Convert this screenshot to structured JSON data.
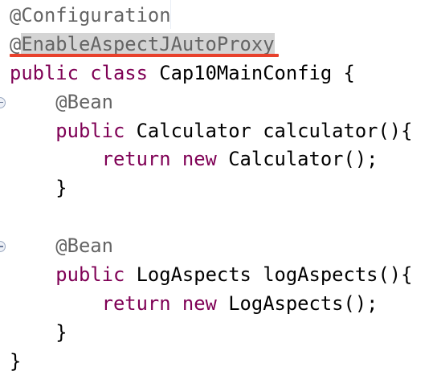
{
  "editor": {
    "lines": [
      {
        "tokens": [
          {
            "t": "@Configuration",
            "c": "ann"
          }
        ]
      },
      {
        "tokens": [
          {
            "t": "@",
            "c": "ann"
          },
          {
            "t": "EnableAspectJAutoProxy",
            "c": "ann hl"
          }
        ]
      },
      {
        "tokens": [
          {
            "t": "public class ",
            "c": "kw"
          },
          {
            "t": "Cap10MainConfig {",
            "c": "id"
          }
        ]
      },
      {
        "tokens": [
          {
            "t": "    @Bean",
            "c": "ann"
          }
        ],
        "fold": true
      },
      {
        "tokens": [
          {
            "t": "    public ",
            "c": "kw"
          },
          {
            "t": "Calculator calculator(){",
            "c": "id"
          }
        ]
      },
      {
        "tokens": [
          {
            "t": "        return new ",
            "c": "kw"
          },
          {
            "t": "Calculator();",
            "c": "id"
          }
        ]
      },
      {
        "tokens": [
          {
            "t": "    }",
            "c": "id"
          }
        ]
      },
      {
        "tokens": [
          {
            "t": "",
            "c": "id"
          }
        ]
      },
      {
        "tokens": [
          {
            "t": "    @Bean",
            "c": "ann"
          }
        ],
        "fold": true
      },
      {
        "tokens": [
          {
            "t": "    public ",
            "c": "kw"
          },
          {
            "t": "LogAspects logAspects(){",
            "c": "id"
          }
        ]
      },
      {
        "tokens": [
          {
            "t": "        return new ",
            "c": "kw"
          },
          {
            "t": "LogAspects();",
            "c": "id"
          }
        ]
      },
      {
        "tokens": [
          {
            "t": "    }",
            "c": "id"
          }
        ]
      },
      {
        "tokens": [
          {
            "t": "}",
            "c": "id"
          }
        ]
      }
    ],
    "colors": {
      "annotation": "#646464",
      "keyword": "#7f0055",
      "text": "#000000",
      "underline": "#e8412c",
      "highlight": "#d4d4d4"
    },
    "icons": {
      "fold": "collapse-circle-minus-icon"
    }
  }
}
